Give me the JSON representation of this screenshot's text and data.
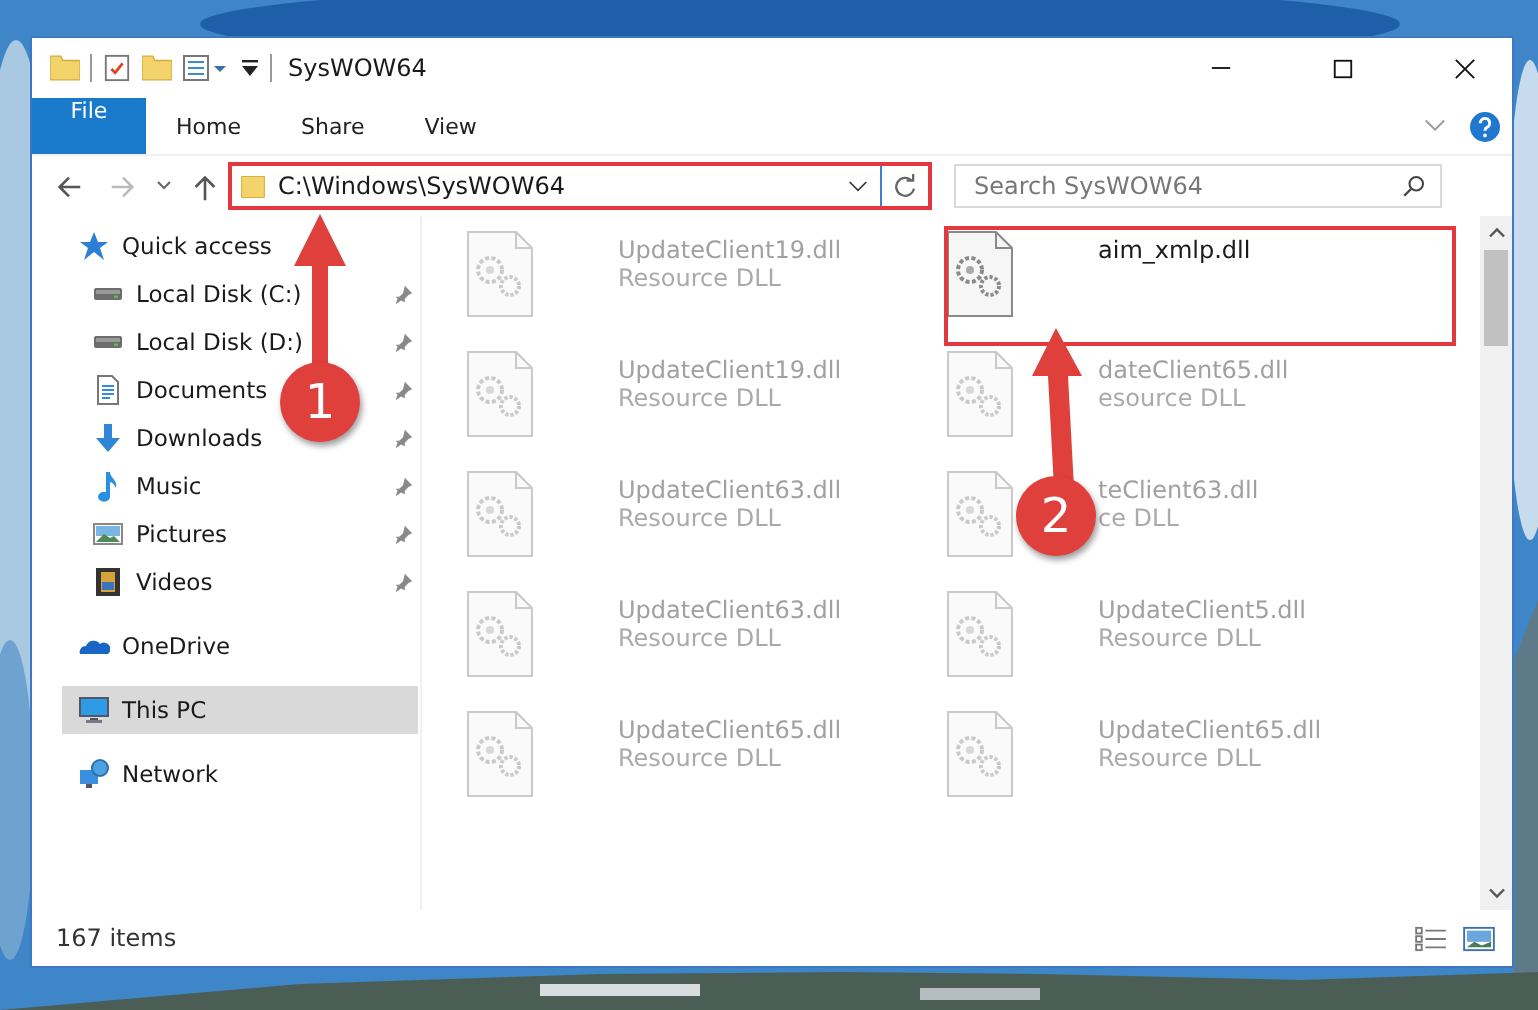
{
  "window": {
    "title": "SysWOW64"
  },
  "ribbon_tabs": [
    {
      "label": "File",
      "kind": "file",
      "selected": false
    },
    {
      "label": "Home",
      "kind": "tab",
      "selected": false
    },
    {
      "label": "Share",
      "kind": "tab",
      "selected": false
    },
    {
      "label": "View",
      "kind": "tab",
      "selected": false
    }
  ],
  "address_bar": {
    "path": "C:\\Windows\\SysWOW64"
  },
  "search": {
    "placeholder": "Search SysWOW64"
  },
  "sidebar": {
    "items": [
      {
        "label": "Quick access",
        "kind": "star",
        "selected": false,
        "children": [
          {
            "label": "Local Disk (C:)",
            "kind": "drive",
            "pinned": true,
            "selected": false
          },
          {
            "label": "Local Disk (D:)",
            "kind": "drive",
            "pinned": true,
            "selected": false
          },
          {
            "label": "Documents",
            "kind": "document",
            "pinned": true,
            "selected": false
          },
          {
            "label": "Downloads",
            "kind": "download",
            "pinned": true,
            "selected": false
          },
          {
            "label": "Music",
            "kind": "music",
            "pinned": true,
            "selected": false
          },
          {
            "label": "Pictures",
            "kind": "pictures",
            "pinned": true,
            "selected": false
          },
          {
            "label": "Videos",
            "kind": "video",
            "pinned": true,
            "selected": false
          }
        ]
      },
      {
        "label": "OneDrive",
        "kind": "cloud",
        "selected": false
      },
      {
        "label": "This PC",
        "kind": "monitor",
        "selected": true
      },
      {
        "label": "Network",
        "kind": "network",
        "selected": false
      }
    ]
  },
  "files": [
    {
      "name": "UpdateClient19.dll",
      "type": "Resource DLL",
      "dimmed": true
    },
    {
      "name": "aim_xmlp.dll",
      "dimmed": false
    },
    {
      "name": "UpdateClient19.dll",
      "type": "Resource DLL",
      "dimmed": true
    },
    {
      "name": "dateClient65.dll",
      "type": "esource DLL",
      "dimmed": true
    },
    {
      "name": "UpdateClient63.dll",
      "type": "Resource DLL",
      "dimmed": true
    },
    {
      "name": "teClient63.dll",
      "type": "ce DLL",
      "dimmed": true
    },
    {
      "name": "UpdateClient63.dll",
      "type": "Resource DLL",
      "dimmed": true
    },
    {
      "name": "UpdateClient5.dll",
      "type": "Resource DLL",
      "dimmed": true
    },
    {
      "name": "UpdateClient65.dll",
      "type": "Resource DLL",
      "dimmed": true
    },
    {
      "name": "UpdateClient65.dll",
      "type": "Resource DLL",
      "dimmed": true
    }
  ],
  "status_bar": {
    "item_count": "167 items"
  },
  "annotations": [
    {
      "number": "1"
    },
    {
      "number": "2"
    }
  ]
}
